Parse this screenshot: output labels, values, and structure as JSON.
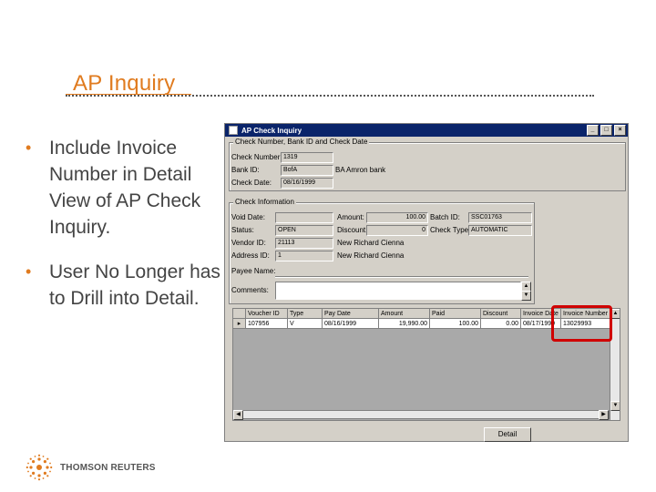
{
  "slide": {
    "title": "AP Inquiry",
    "bullets": [
      "Include Invoice Number in Detail View of AP Check Inquiry.",
      "User No Longer has to Drill into Detail."
    ],
    "logo_text": "THOMSON REUTERS",
    "accent_color": "#e07b1f"
  },
  "window": {
    "title": "AP Check Inquiry",
    "group1": {
      "label": "Check Number, Bank ID and Check Date",
      "check_number_label": "Check Number:",
      "check_number": "1319",
      "bank_id_label": "Bank ID:",
      "bank_id": "BofA",
      "bank_name": "BA Amron bank",
      "check_date_label": "Check Date:",
      "check_date": "08/16/1999"
    },
    "group2": {
      "label": "Check Information",
      "void_date_label": "Void Date:",
      "void_date": "",
      "amount_label": "Amount:",
      "amount": "100.00",
      "batch_id_label": "Batch ID:",
      "batch_id": "SSC01763",
      "status_label": "Status:",
      "status": "OPEN",
      "discount_label": "Discount:",
      "discount": "0",
      "check_type_label": "Check Type:",
      "check_type": "AUTOMATIC",
      "vendor_id_label": "Vendor ID:",
      "vendor_id": "21113",
      "vendor_name": "New Richard Cienna",
      "address_id_label": "Address ID:",
      "address_id": "1",
      "address_name": "New Richard Cienna",
      "payee_name_label": "Payee Name:",
      "payee_name": "",
      "comments_label": "Comments:",
      "comments": ""
    },
    "grid": {
      "columns": [
        "",
        "Voucher ID",
        "Type",
        "Pay Date",
        "Amount",
        "Paid",
        "Discount",
        "Invoice Date",
        "Invoice Number"
      ],
      "rows": [
        [
          "▸",
          "107956",
          "V",
          "08/16/1999",
          "19,990.00",
          "100.00",
          "0.00",
          "08/17/1999",
          "13029993"
        ]
      ]
    },
    "detail_button": "Detail",
    "highlight_color": "#d00000"
  }
}
